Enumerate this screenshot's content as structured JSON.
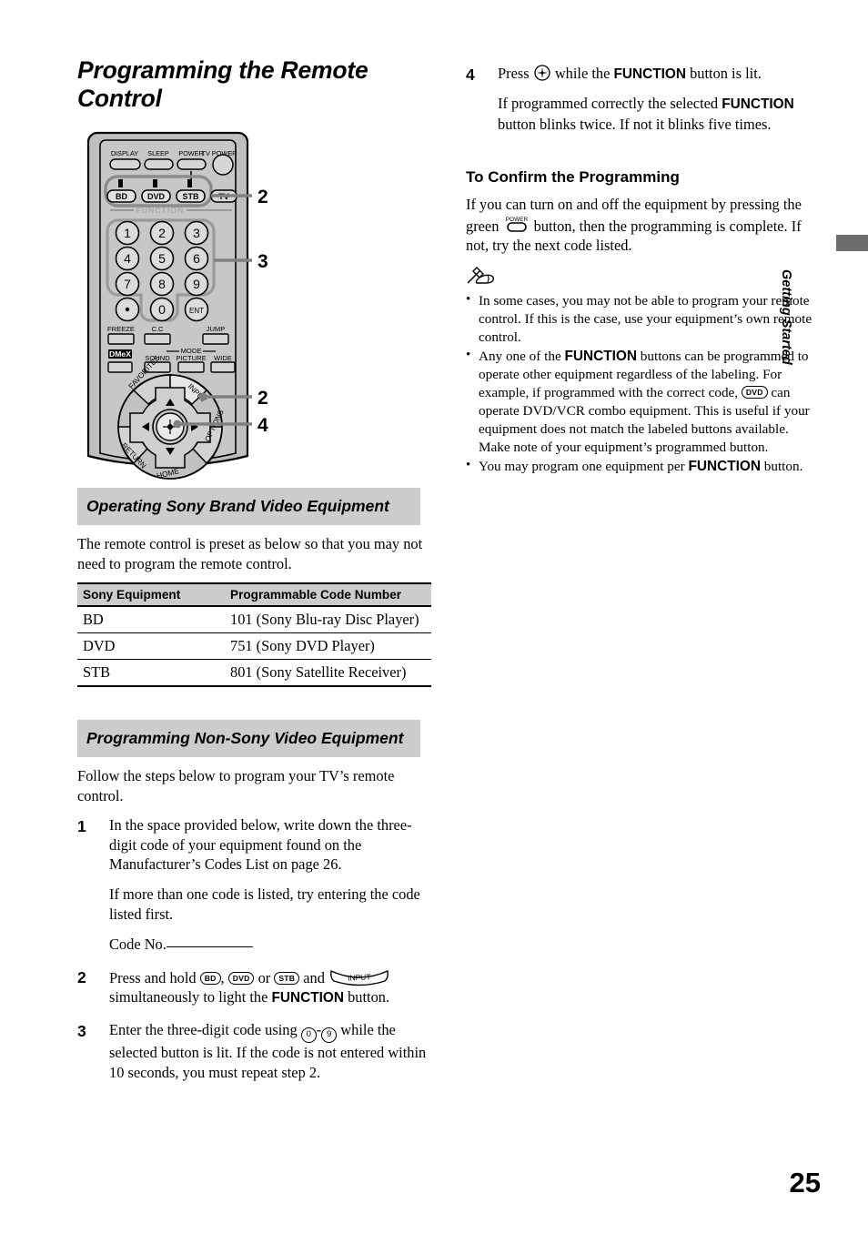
{
  "document": {
    "title": "Programming the Remote Control",
    "page_number": "25",
    "side_tab_label": "Getting Started"
  },
  "illustration": {
    "name": "remote-control-diagram",
    "top_buttons": [
      "DISPLAY",
      "SLEEP",
      "POWER",
      "TV POWER"
    ],
    "function_buttons": [
      "BD",
      "DVD",
      "STB"
    ],
    "tv_button": "TV",
    "function_label": "FUNCTION",
    "keypad": [
      "1",
      "2",
      "3",
      "4",
      "5",
      "6",
      "7",
      "8",
      "9",
      "0"
    ],
    "keypad_extra": [
      "•",
      "ENT"
    ],
    "lower_row_1": [
      "FREEZE",
      "C.C",
      "JUMP"
    ],
    "lower_row_2": [
      "DMeX",
      "SOUND",
      "PICTURE",
      "WIDE"
    ],
    "mode_label": "MODE",
    "pad_labels": [
      "FAVORITES",
      "INPUT",
      "RETURN",
      "HOME",
      "OPTIONS"
    ],
    "callouts": [
      "2",
      "3",
      "2",
      "4"
    ]
  },
  "left_column": {
    "section_sony": {
      "heading": "Operating Sony Brand Video Equipment",
      "intro": "The remote control is preset as below so that you may not need to program the remote control.",
      "table": {
        "headers": [
          "Sony Equipment",
          "Programmable Code Number"
        ],
        "rows": [
          [
            "BD",
            "101 (Sony Blu-ray Disc Player)"
          ],
          [
            "DVD",
            "751 (Sony DVD Player)"
          ],
          [
            "STB",
            "801 (Sony Satellite Receiver)"
          ]
        ]
      }
    },
    "section_nonsony": {
      "heading": "Programming Non-Sony Video Equipment",
      "intro": "Follow the steps below to program your TV’s remote control.",
      "steps": [
        {
          "num": "1",
          "para1": "In the space provided below, write down the three-digit code of your equipment found on the Manufacturer’s Codes List on page 26.",
          "para2": "If more than one code is listed, try entering the code listed first.",
          "code_label": "Code No."
        },
        {
          "num": "2",
          "t1": "Press and hold ",
          "b1": "BD",
          "t2": ", ",
          "b2": "DVD",
          "t3": " or ",
          "b3": "STB",
          "t4": " and ",
          "b4": "INPUT",
          "t5": " simultaneously to light the ",
          "strong": "FUNCTION",
          "t6": " button."
        },
        {
          "num": "3",
          "t1": "Enter the three-digit code using ",
          "b1": "0",
          "t2": "-",
          "b2": "9",
          "t3": " while the selected button is lit. If the code is not entered within 10 seconds, you must repeat step 2."
        }
      ]
    }
  },
  "right_column": {
    "step4": {
      "num": "4",
      "t1": "Press ",
      "icon": "select-button-icon",
      "t2": " while the ",
      "strong": "FUNCTION",
      "t3": " button is lit.",
      "para2_a": "If programmed correctly the selected ",
      "para2_strong": "FUNCTION",
      "para2_b": " button blinks twice. If not it blinks five times."
    },
    "confirm": {
      "heading": "To Confirm the Programming",
      "t1": "If you can turn on and off the equipment by pressing the green ",
      "icon": "power-button-icon",
      "t2": " button, then the programming is complete. If not, try the next code listed."
    },
    "notes": {
      "icon": "note-pencil-icon",
      "items": [
        {
          "t1": "In some cases, you may not be able to program your remote control. If this is the case, use your equipment’s own remote control."
        },
        {
          "t1": "Any one of the ",
          "strong1": "FUNCTION",
          "t2": " buttons can be programmed to operate other equipment regardless of the labeling. For example, if programmed with the correct code, ",
          "btn": "DVD",
          "t3": " can operate DVD/VCR combo equipment. This is useful if your equipment does not match the labeled buttons available. Make note of your equipment’s programmed  button."
        },
        {
          "t1": "You may program one equipment per ",
          "strong1": "FUNCTION",
          "t2": " button."
        }
      ]
    }
  },
  "colors": {
    "heading_bar": "#cccccc",
    "side_tab": "#6d6d6d",
    "remote_body": "#bfbfbf",
    "remote_button": "#d4d4d4"
  }
}
